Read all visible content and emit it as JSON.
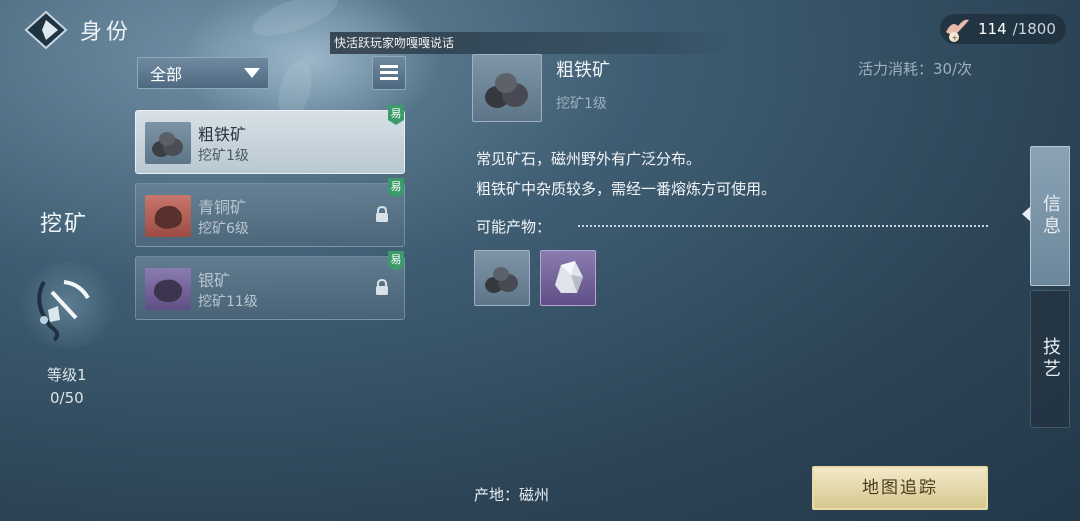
{
  "header": {
    "title": "身份",
    "ticker": "快活跃玩家吻嘎嘎说话",
    "energy_current": "114",
    "energy_max": "/1800"
  },
  "skill": {
    "name": "挖矿",
    "level": "等级1",
    "exp": "0/50"
  },
  "filter": {
    "selected": "全部"
  },
  "ores": [
    {
      "name": "粗铁矿",
      "level": "挖矿1级",
      "badge": "易",
      "selected": true,
      "locked": false
    },
    {
      "name": "青铜矿",
      "level": "挖矿6级",
      "badge": "易",
      "selected": false,
      "locked": true
    },
    {
      "name": "银矿",
      "level": "挖矿11级",
      "badge": "易",
      "selected": false,
      "locked": true
    }
  ],
  "detail": {
    "name": "粗铁矿",
    "level": "挖矿1级",
    "cost": "活力消耗：30/次",
    "desc_line1": "常见矿石，磁州野外有广泛分布。",
    "desc_line2": "粗铁矿中杂质较多，需经一番熔炼方可使用。",
    "drops_label": "可能产物：",
    "origin": "产地：磁州",
    "map_button": "地图追踪"
  },
  "tabs": {
    "info": "信息",
    "craft": "技艺"
  },
  "colors": {
    "easy_badge": "#3d9a6b",
    "selected_item": "#c9d4dc",
    "map_button": "#e4d7a4",
    "purple_rarity": "#7a6aa4"
  }
}
